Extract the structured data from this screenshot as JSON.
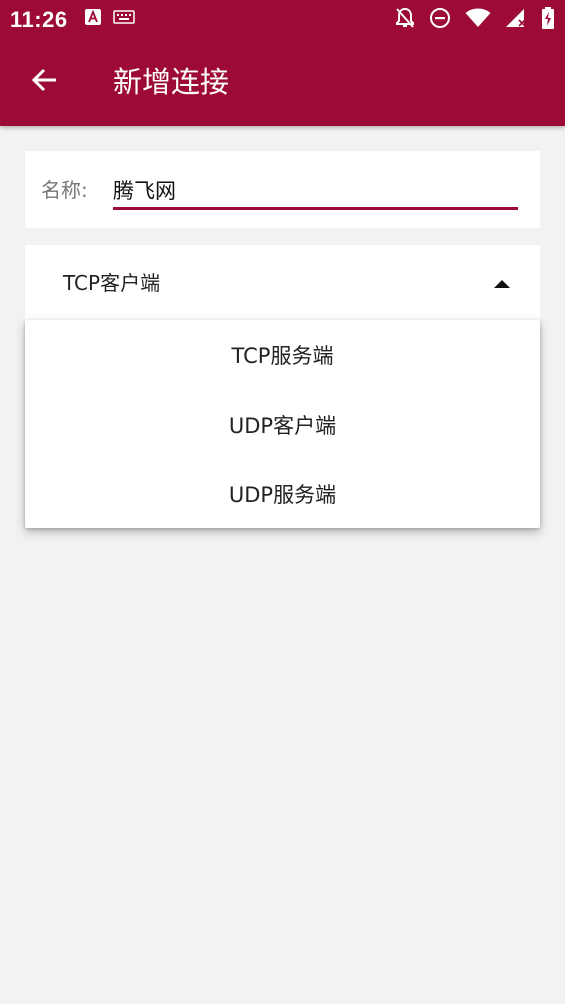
{
  "status_bar": {
    "time": "11:26",
    "left_icons": [
      "a-notification-icon",
      "keyboard-icon"
    ],
    "right_icons": [
      "bell-off-icon",
      "do-not-disturb-icon",
      "wifi-icon",
      "signal-icon",
      "battery-charging-icon"
    ]
  },
  "app_bar": {
    "title": "新增连接",
    "back_icon": "arrow-left-icon",
    "color": "#9d0a36"
  },
  "form": {
    "name_label": "名称:",
    "name_value": "腾飞网",
    "underline_color": "#9d0a36"
  },
  "type_select": {
    "selected": "TCP客户端",
    "caret_icon": "caret-up-icon",
    "options": [
      "TCP服务端",
      "UDP客户端",
      "UDP服务端"
    ]
  }
}
